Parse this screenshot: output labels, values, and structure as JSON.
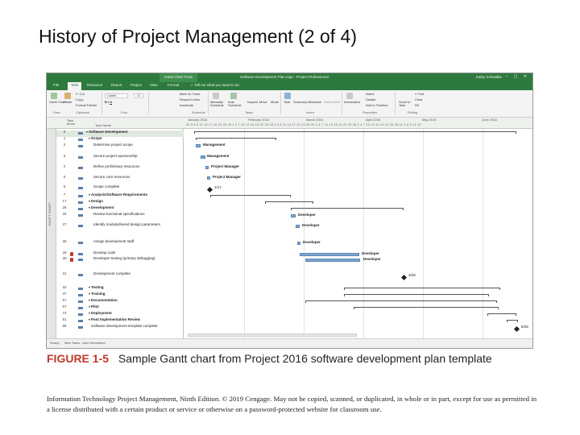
{
  "slide": {
    "title": "History of Project Management (2 of 4)"
  },
  "app": {
    "window_title": "Software Development Plan.mpp - Project Professional",
    "context_tab": "Gantt Chart Tools",
    "tell_me": "Tell me what you want to do",
    "user": "Kathy Schwalbe",
    "tabs": [
      "File",
      "Task",
      "Resource",
      "Report",
      "Project",
      "View",
      "Format"
    ],
    "active_tab": "Task",
    "ribbon": {
      "groups": [
        "View",
        "Clipboard",
        "Font",
        "Schedule",
        "Tasks",
        "Insert",
        "Properties",
        "Editing"
      ],
      "buttons": {
        "gantt": "Gantt Chart",
        "paste": "Paste",
        "cut": "Cut",
        "copy": "Copy",
        "format_painter": "Format Painter",
        "font_name": "Calibri",
        "font_size": "11",
        "mark_on_track": "Mark on Track",
        "respect_links": "Respect Links",
        "inactivate": "Inactivate",
        "manually": "Manually Schedule",
        "auto": "Auto Schedule",
        "inspect": "Inspect",
        "move": "Move",
        "mode": "Mode",
        "task": "Task",
        "summary": "Summary",
        "milestone": "Milestone",
        "deliverable": "Deliverable",
        "information": "Information",
        "notes": "Notes",
        "details": "Details",
        "add_to_timeline": "Add to Timeline",
        "scroll_to_task": "Scroll to Task",
        "find": "Find",
        "clear": "Clear",
        "fill": "Fill"
      }
    },
    "columns": {
      "mode": "Task Mode",
      "name": "Task Name"
    },
    "timeline_months": [
      "January 2016",
      "February 2016",
      "March 2016",
      "April 2016",
      "May 2016",
      "June 2016"
    ],
    "timeline_days": "20 3 6 9 11 14 17 20 23 26 29 1 4 7 10 13 16 19 22 25 28 2 5 8 11 14 17 20 23 26 29 1 4 7 10 13 16 19 22 25 28 1 4 7 10 13 16 19 22 25 28 31 3 6 9 12 15",
    "sidebar_label": "GANTT CHART",
    "status": {
      "ready": "Ready",
      "new_tasks": "New Tasks : Auto Scheduled"
    }
  },
  "tasks": [
    {
      "id": "0",
      "name": "Software Development",
      "level": 0,
      "summary": true
    },
    {
      "id": "1",
      "name": "Scope",
      "level": 1,
      "summary": true
    },
    {
      "id": "2",
      "name": "Determine project scope",
      "level": 2
    },
    {
      "id": "3",
      "name": "Secure project sponsorship",
      "level": 2
    },
    {
      "id": "4",
      "name": "Define preliminary resources",
      "level": 2
    },
    {
      "id": "5",
      "name": "Secure core resources",
      "level": 2
    },
    {
      "id": "6",
      "name": "Scope complete",
      "level": 2
    },
    {
      "id": "7",
      "name": "Analysis/Software Requirements",
      "level": 1,
      "summary": true
    },
    {
      "id": "17",
      "name": "Design",
      "level": 1,
      "summary": true
    },
    {
      "id": "25",
      "name": "Development",
      "level": 1,
      "summary": true
    },
    {
      "id": "26",
      "name": "Review functional specifications",
      "level": 2
    },
    {
      "id": "27",
      "name": "Identify modular/tiered design parameters",
      "level": 2
    },
    {
      "id": "28",
      "name": "Assign development staff",
      "level": 2
    },
    {
      "id": "29",
      "name": "Develop code",
      "level": 2
    },
    {
      "id": "30",
      "name": "Developer testing (primary debugging)",
      "level": 2
    },
    {
      "id": "31",
      "name": "Development complete",
      "level": 2
    },
    {
      "id": "32",
      "name": "Testing",
      "level": 1,
      "summary": true
    },
    {
      "id": "47",
      "name": "Training",
      "level": 1,
      "summary": true
    },
    {
      "id": "57",
      "name": "Documentation",
      "level": 1,
      "summary": true
    },
    {
      "id": "67",
      "name": "Pilot",
      "level": 1,
      "summary": true
    },
    {
      "id": "74",
      "name": "Deployment",
      "level": 1,
      "summary": true
    },
    {
      "id": "81",
      "name": "Post Implementation Review",
      "level": 1,
      "summary": true
    },
    {
      "id": "86",
      "name": "Software development template complete",
      "level": 1
    }
  ],
  "gantt_labels": {
    "management_1": "Management",
    "management_2": "Management",
    "pm_1": "Project Manager",
    "pm_2": "Project Manager",
    "ms_scope": "1/17",
    "dev_1": "Developer",
    "dev_2": "Developer",
    "dev_3": "Developer",
    "dev_4": "Developer",
    "dev_5": "Developer",
    "ms_dev": "3/28",
    "ms_final": "5/25"
  },
  "caption": {
    "figure_number": "FIGURE 1-5",
    "text": "Sample Gantt chart from Project 2016 software development plan template"
  },
  "footer": {
    "text": "Information Technology Project Management, Ninth Edition. © 2019 Cengage. May not be copied, scanned, or duplicated, in whole or in part, except for use as permitted in a license distributed with a certain product or service or otherwise on a password-protected website for classroom use."
  },
  "colors": {
    "ribbon_green": "#2e7a3e",
    "task_bar": "#7ea7cf",
    "figure_red": "#c0392b"
  }
}
